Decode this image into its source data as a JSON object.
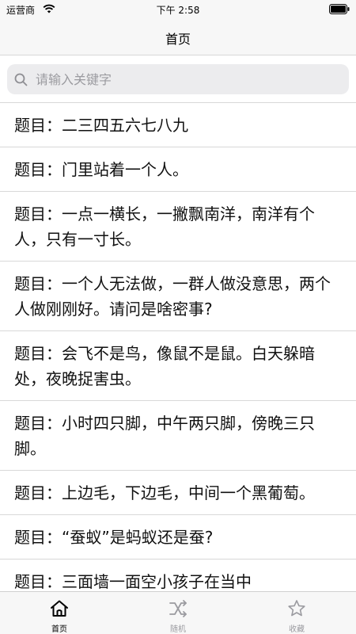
{
  "status": {
    "carrier": "运营商",
    "time": "下午 2:58"
  },
  "nav": {
    "title": "首页"
  },
  "search": {
    "placeholder": "请输入关键字"
  },
  "items": [
    {
      "label": "题目：二三四五六七八九"
    },
    {
      "label": "题目：门里站着一个人。"
    },
    {
      "label": "题目：一点一横长，一撇飘南洋，南洋有个人，只有一寸长。"
    },
    {
      "label": "题目：一个人无法做，一群人做没意思，两个人做刚刚好。请问是啥密事?"
    },
    {
      "label": "题目：会飞不是鸟，像鼠不是鼠。白天躲暗处，夜晚捉害虫。"
    },
    {
      "label": "题目：小时四只脚，中午两只脚，傍晚三只脚。"
    },
    {
      "label": "题目：上边毛，下边毛，中间一个黑葡萄。"
    },
    {
      "label": "题目：“蚕蚁”是蚂蚁还是蚕?"
    },
    {
      "label": "题目：三面墙一面空小孩子在当中"
    }
  ],
  "tabs": [
    {
      "label": "首页",
      "icon": "home-icon",
      "active": true
    },
    {
      "label": "随机",
      "icon": "shuffle-icon",
      "active": false
    },
    {
      "label": "收藏",
      "icon": "star-icon",
      "active": false
    }
  ],
  "colors": {
    "active": "#000000",
    "inactive": "#9b9ba0",
    "separator": "#d8d8d8"
  }
}
